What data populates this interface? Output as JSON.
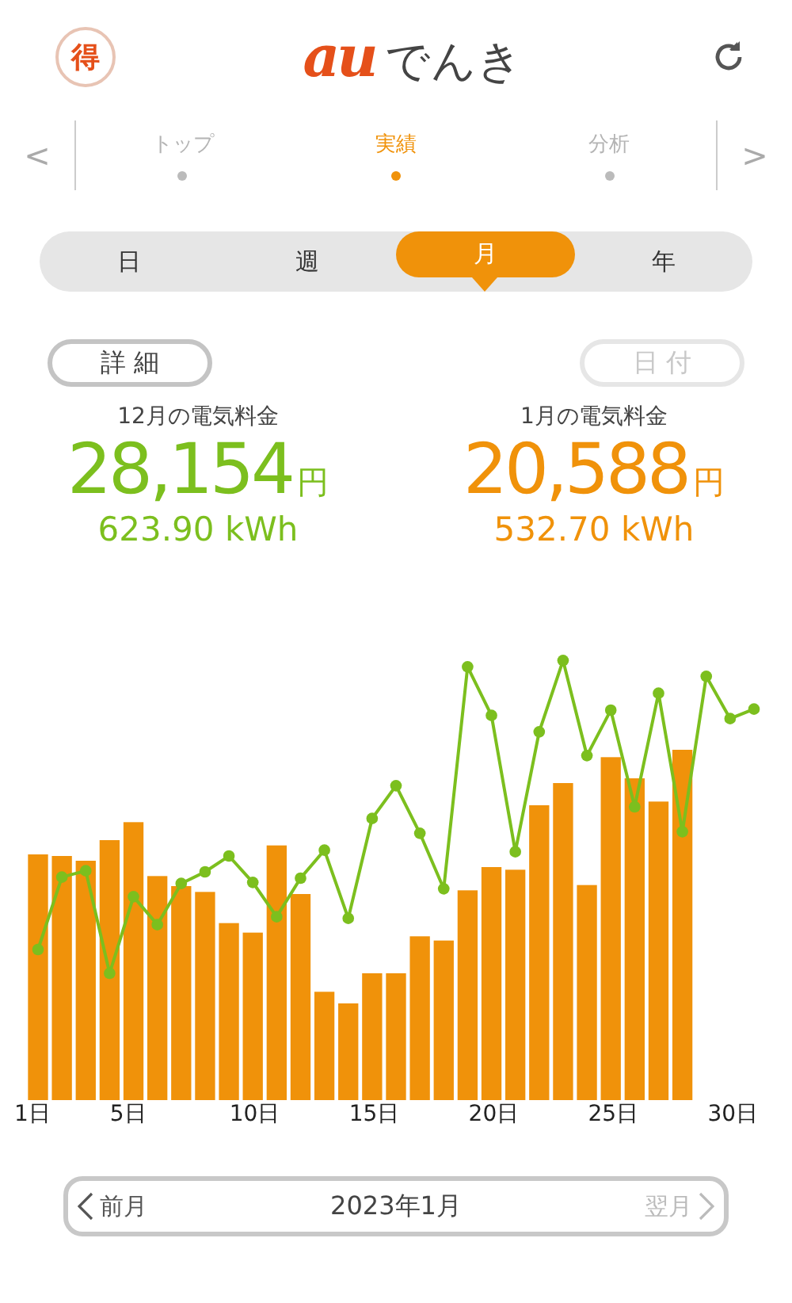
{
  "header": {
    "badge": "得",
    "logo_brand": "au",
    "logo_text": "でんき"
  },
  "nav": {
    "prev": "<",
    "next": ">",
    "tabs": [
      {
        "label": "トップ",
        "selected": false
      },
      {
        "label": "実績",
        "selected": true
      },
      {
        "label": "分析",
        "selected": false
      }
    ]
  },
  "periods": [
    {
      "label": "日",
      "selected": false
    },
    {
      "label": "週",
      "selected": false
    },
    {
      "label": "月",
      "selected": true
    },
    {
      "label": "年",
      "selected": false
    }
  ],
  "buttons": [
    {
      "label": "詳 細",
      "disabled": false
    },
    {
      "label": "日 付",
      "disabled": true
    }
  ],
  "summaries": [
    {
      "title": "12月の電気料金",
      "amount": "28,154",
      "unit": "円",
      "energy": "623.90 kWh",
      "color": "#7cbf1e"
    },
    {
      "title": "1月の電気料金",
      "amount": "20,588",
      "unit": "円",
      "energy": "532.70 kWh",
      "color": "#f0920a"
    }
  ],
  "chart": {
    "x_labels": [
      "1日",
      "5日",
      "10日",
      "15日",
      "20日",
      "25日",
      "30日"
    ]
  },
  "month_nav": {
    "prev": {
      "label": "前月",
      "disabled": false
    },
    "current": "2023年1月",
    "next": {
      "label": "翌月",
      "disabled": true
    }
  }
}
